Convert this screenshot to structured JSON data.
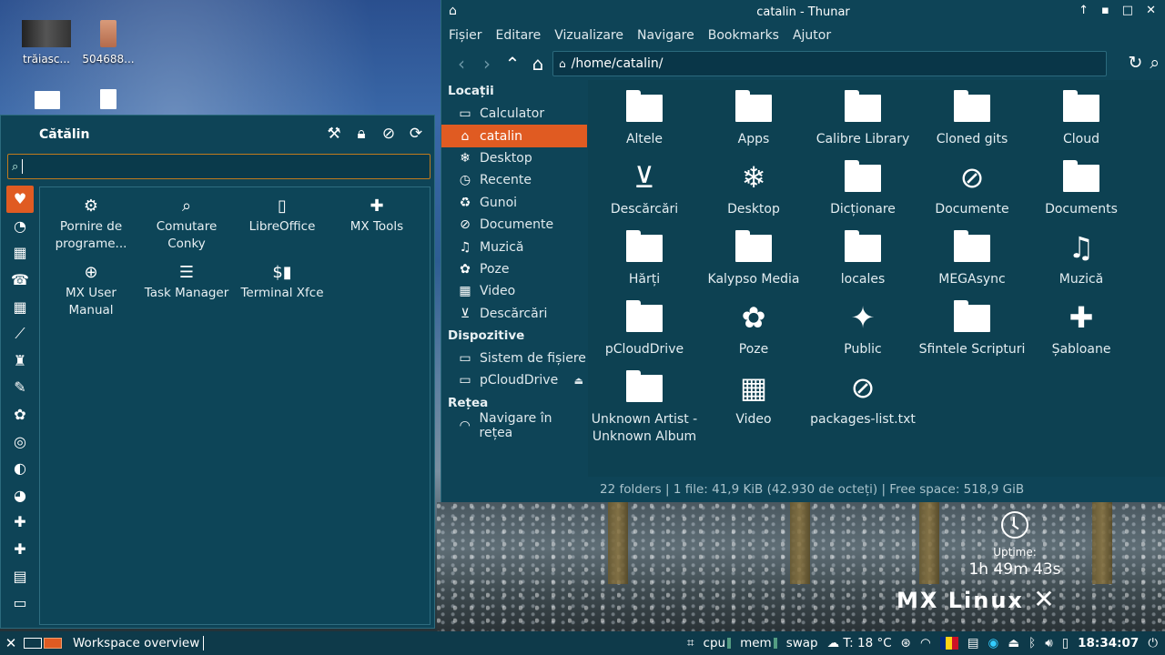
{
  "desktop": {
    "icons": [
      {
        "label": "trăiasc..."
      },
      {
        "label": "504688..."
      }
    ]
  },
  "menu": {
    "user": "Cătălin",
    "apps": [
      {
        "label": "Pornire de programe...",
        "icon": "startup-icon"
      },
      {
        "label": "Comutare Conky",
        "icon": "conky-icon"
      },
      {
        "label": "LibreOffice",
        "icon": "libreoffice-icon"
      },
      {
        "label": "MX Tools",
        "icon": "puzzle-icon"
      },
      {
        "label": "MX User Manual",
        "icon": "lifebuoy-icon"
      },
      {
        "label": "Task Manager",
        "icon": "task-manager-icon"
      },
      {
        "label": "Terminal Xfce",
        "icon": "terminal-icon"
      }
    ]
  },
  "thunar": {
    "title": "catalin - Thunar",
    "menus": [
      "Fișier",
      "Editare",
      "Vizualizare",
      "Navigare",
      "Bookmarks",
      "Ajutor"
    ],
    "location": "/home/catalin/",
    "sidebar": {
      "places_header": "Locații",
      "places": [
        {
          "label": "Calculator",
          "icon": "computer-icon"
        },
        {
          "label": "catalin",
          "icon": "home-icon",
          "active": true
        },
        {
          "label": "Desktop",
          "icon": "snowflake-icon"
        },
        {
          "label": "Recente",
          "icon": "recent-icon"
        },
        {
          "label": "Gunoi",
          "icon": "trash-icon"
        },
        {
          "label": "Documente",
          "icon": "paperclip-icon"
        },
        {
          "label": "Muzică",
          "icon": "music-icon"
        },
        {
          "label": "Poze",
          "icon": "flower-icon"
        },
        {
          "label": "Video",
          "icon": "film-icon"
        },
        {
          "label": "Descărcări",
          "icon": "download-icon"
        }
      ],
      "devices_header": "Dispozitive",
      "devices": [
        {
          "label": "Sistem de fișiere",
          "icon": "drive-icon"
        },
        {
          "label": "pCloudDrive",
          "icon": "drive-icon",
          "eject": true
        }
      ],
      "network_header": "Rețea",
      "network": [
        {
          "label": "Navigare în rețea",
          "icon": "wifi-icon"
        }
      ]
    },
    "files": [
      {
        "label": "Altele",
        "kind": "folder"
      },
      {
        "label": "Apps",
        "kind": "folder"
      },
      {
        "label": "Calibre Library",
        "kind": "folder"
      },
      {
        "label": "Cloned gits",
        "kind": "folder"
      },
      {
        "label": "Cloud",
        "kind": "folder"
      },
      {
        "label": "Descărcări",
        "kind": "download"
      },
      {
        "label": "Desktop",
        "kind": "snowflake"
      },
      {
        "label": "Dicționare",
        "kind": "folder"
      },
      {
        "label": "Documente",
        "kind": "paperclip"
      },
      {
        "label": "Documents",
        "kind": "folder"
      },
      {
        "label": "Hărți",
        "kind": "folder"
      },
      {
        "label": "Kalypso Media",
        "kind": "folder"
      },
      {
        "label": "locales",
        "kind": "folder"
      },
      {
        "label": "MEGAsync",
        "kind": "folder"
      },
      {
        "label": "Muzică",
        "kind": "music"
      },
      {
        "label": "pCloudDrive",
        "kind": "folder"
      },
      {
        "label": "Poze",
        "kind": "flower"
      },
      {
        "label": "Public",
        "kind": "public"
      },
      {
        "label": "Sfintele Scripturi",
        "kind": "folder"
      },
      {
        "label": "Șabloane",
        "kind": "puzzle"
      },
      {
        "label": "Unknown Artist - Unknown Album",
        "kind": "folder"
      },
      {
        "label": "Video",
        "kind": "film"
      },
      {
        "label": "packages-list.txt",
        "kind": "paperclip"
      }
    ],
    "status": "22 folders  |  1 file: 41,9 KiB (42.930 de octeți)  |  Free space: 518,9 GiB"
  },
  "conky": {
    "uptime_label": "Uptime:",
    "uptime_value": "1h 49m 43s",
    "logo": "MX Linux"
  },
  "taskbar": {
    "task": "Workspace overview",
    "cpu": "cpu",
    "mem": "mem",
    "swap": "swap",
    "weather": "T: 18 °C",
    "time": "18:34:07"
  }
}
